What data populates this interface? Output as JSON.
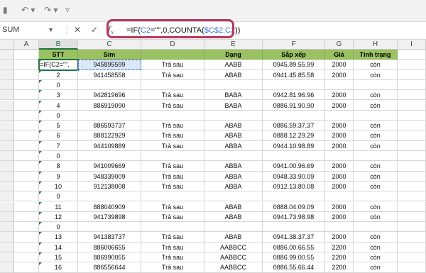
{
  "name_box": "SUM",
  "formula": {
    "prefix": "=IF(",
    "ref1": "C2",
    "mid": "=\"\",0,COUNTA(",
    "ref2": "$C$2:C2",
    "suffix": "))"
  },
  "columns": [
    "A",
    "B",
    "C",
    "D",
    "E",
    "F",
    "G",
    "H",
    "I"
  ],
  "headers": {
    "stt": "STT",
    "sim": "Sim",
    "dang": "Dạng",
    "sapxep": "Sắp xếp",
    "gia": "Giá",
    "tinhtrang": "Tình trạng"
  },
  "active_cell_text": "=IF(C2=\"\",",
  "rows": [
    {
      "stt": "",
      "sim": "945895599",
      "loai": "Trả sau",
      "dang": "AABB",
      "sx": "0945.89.55.99",
      "gia": "2000",
      "tt": "còn"
    },
    {
      "stt": "2",
      "sim": "941458558",
      "loai": "Trả sau",
      "dang": "ABAB",
      "sx": "0941.45.85.58",
      "gia": "2000",
      "tt": "còn"
    },
    {
      "stt": "0",
      "sim": "",
      "loai": "",
      "dang": "",
      "sx": "",
      "gia": "",
      "tt": ""
    },
    {
      "stt": "3",
      "sim": "942819696",
      "loai": "Trả sau",
      "dang": "BABA",
      "sx": "0942.81.96.96",
      "gia": "2000",
      "tt": "còn"
    },
    {
      "stt": "4",
      "sim": "886919090",
      "loai": "Trả sau",
      "dang": "BABA",
      "sx": "0886.91.90.90",
      "gia": "2000",
      "tt": "còn"
    },
    {
      "stt": "0",
      "sim": "",
      "loai": "",
      "dang": "",
      "sx": "",
      "gia": "",
      "tt": ""
    },
    {
      "stt": "5",
      "sim": "886593737",
      "loai": "Trả sau",
      "dang": "ABAB",
      "sx": "0886.59.37.37",
      "gia": "2000",
      "tt": "còn"
    },
    {
      "stt": "6",
      "sim": "888122929",
      "loai": "Trả sau",
      "dang": "ABAB",
      "sx": "0888.12.29.29",
      "gia": "2000",
      "tt": "còn"
    },
    {
      "stt": "7",
      "sim": "944109889",
      "loai": "Trả sau",
      "dang": "ABBA",
      "sx": "0944.10.98.89",
      "gia": "2000",
      "tt": "còn"
    },
    {
      "stt": "0",
      "sim": "",
      "loai": "",
      "dang": "",
      "sx": "",
      "gia": "",
      "tt": ""
    },
    {
      "stt": "8",
      "sim": "941009669",
      "loai": "Trả sau",
      "dang": "ABBA",
      "sx": "0941.00.96.69",
      "gia": "2000",
      "tt": "còn"
    },
    {
      "stt": "9",
      "sim": "948339009",
      "loai": "Trả sau",
      "dang": "ABBA",
      "sx": "0948.33.90.09",
      "gia": "2000",
      "tt": "còn"
    },
    {
      "stt": "10",
      "sim": "912138008",
      "loai": "Trả sau",
      "dang": "ABBA",
      "sx": "0912.13.80.08",
      "gia": "2000",
      "tt": "còn"
    },
    {
      "stt": "0",
      "sim": "",
      "loai": "",
      "dang": "",
      "sx": "",
      "gia": "",
      "tt": ""
    },
    {
      "stt": "11",
      "sim": "888040909",
      "loai": "Trả sau",
      "dang": "ABAB",
      "sx": "0888.04.09.09",
      "gia": "2000",
      "tt": "còn"
    },
    {
      "stt": "12",
      "sim": "941739898",
      "loai": "Trả sau",
      "dang": "ABAB",
      "sx": "0941.73.98.98",
      "gia": "2000",
      "tt": "còn"
    },
    {
      "stt": "0",
      "sim": "",
      "loai": "",
      "dang": "",
      "sx": "",
      "gia": "",
      "tt": ""
    },
    {
      "stt": "13",
      "sim": "941383737",
      "loai": "Trả sau",
      "dang": "ABAB",
      "sx": "0941.38.37.37",
      "gia": "2000",
      "tt": "còn"
    },
    {
      "stt": "14",
      "sim": "886006655",
      "loai": "Trả sau",
      "dang": "AABBCC",
      "sx": "0886.00.66.55",
      "gia": "2200",
      "tt": "còn"
    },
    {
      "stt": "15",
      "sim": "886990055",
      "loai": "Trả sau",
      "dang": "AABBCC",
      "sx": "0886.99.00.55",
      "gia": "2200",
      "tt": "còn"
    },
    {
      "stt": "16",
      "sim": "886556644",
      "loai": "Trả sau",
      "dang": "AABBCC",
      "sx": "0886.55.66.44",
      "gia": "2200",
      "tt": "còn"
    }
  ]
}
